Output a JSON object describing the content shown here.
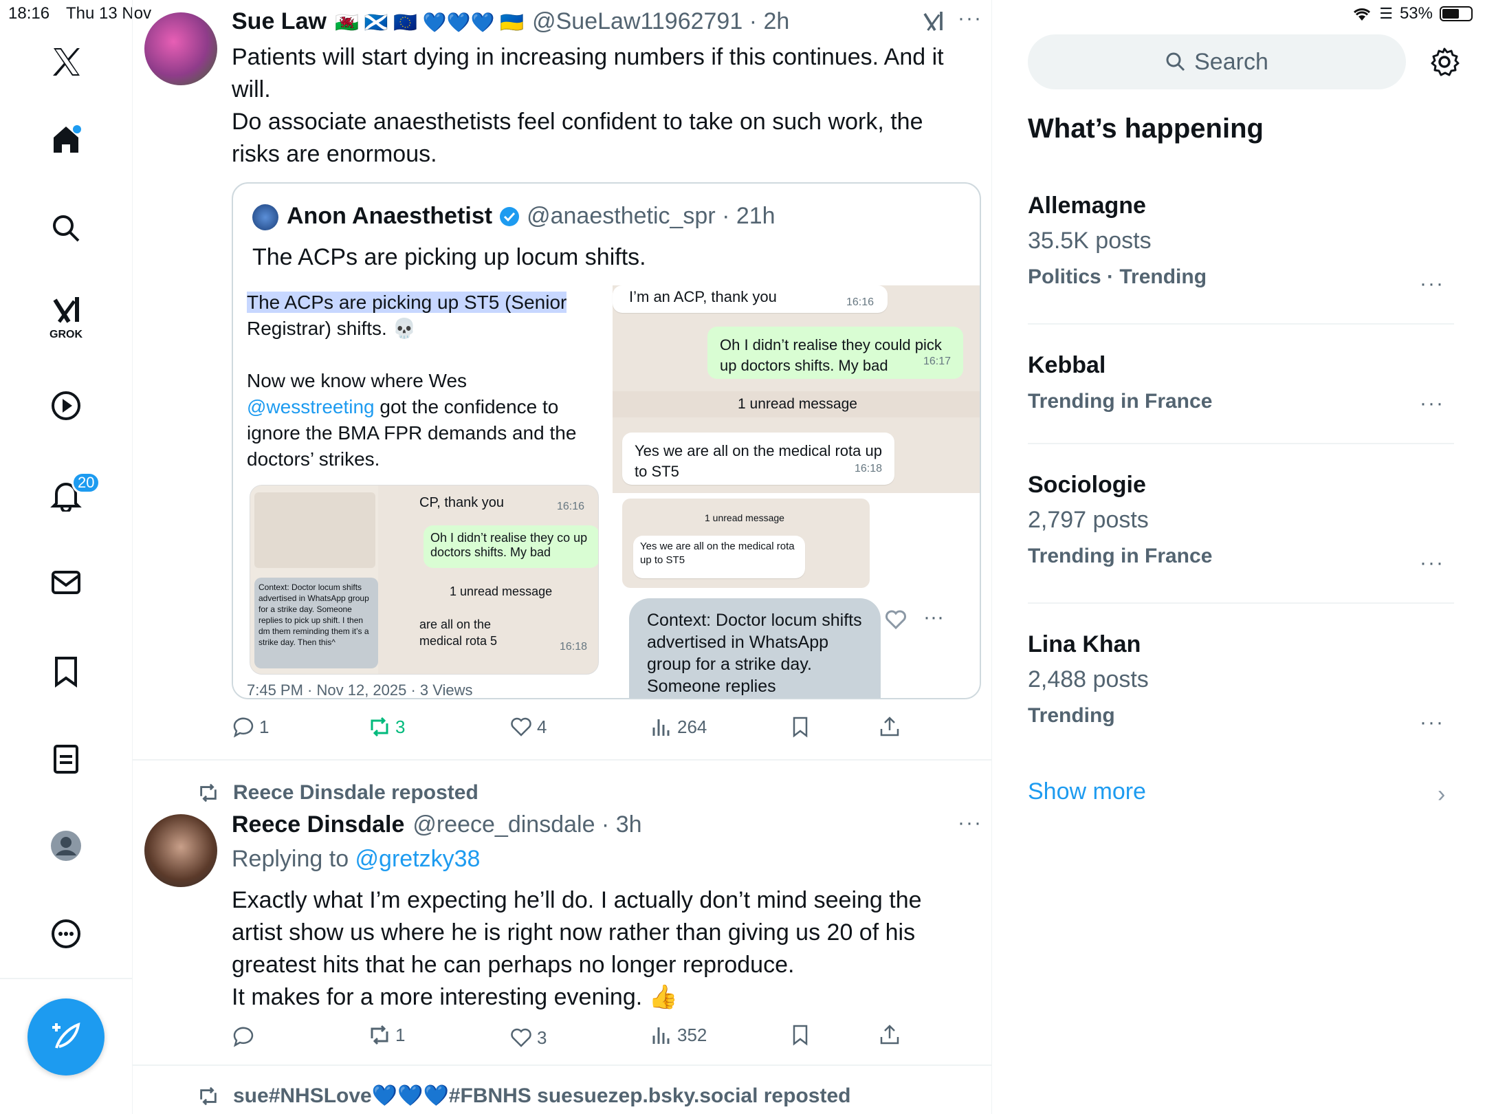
{
  "status_bar": {
    "time": "18:16",
    "date": "Thu 13 Nov",
    "battery": "53%"
  },
  "nav": {
    "grok_label": "GROK",
    "notifications_badge": "20"
  },
  "tweet1": {
    "name": "Sue Law",
    "name_emojis": "🏴󠁧󠁢󠁷󠁬󠁳󠁿 🏴󠁧󠁢󠁳󠁣󠁴󠁿 🇪🇺 💙💙💙 🇺🇦",
    "handle_time": "@SueLaw11962791 · 2h",
    "body_line1": "Patients will start dying in increasing numbers if this continues. And it",
    "body_line2": "will.",
    "body_line3": "Do associate anaesthetists feel confident to take on such work, the",
    "body_line4": "risks are enormous.",
    "quote": {
      "name": "Anon Anaesthetist",
      "handle_time": "@anaesthetic_spr · 21h",
      "text": "The ACPs are picking up locum shifts.",
      "img_left": {
        "line1": "The ACPs are picking up ST5 (Senior",
        "line2": "Registrar) shifts. 💀",
        "line3": "Now we know where Wes",
        "line4_mention": "@wesstreeting",
        "line4_rest": " got the confidence to",
        "line5": "ignore the BMA FPR demands and the",
        "line6": "doctors’ strikes."
      },
      "img_right": {
        "msg1": "I’m an ACP, thank you",
        "msg1_time": "16:16",
        "msg2": "Oh I didn’t realise they could pick up doctors shifts. My bad",
        "msg2_time": "16:17",
        "unread": "1 unread message",
        "msg3": "Yes we are all on the medical rota up to ST5",
        "msg3_time": "16:18"
      },
      "thumb": {
        "msg1": "CP, thank you",
        "msg1_time": "16:16",
        "msg2": "Oh I didn’t realise they co up doctors shifts. My bad",
        "unread": "1 unread message",
        "msg3": "are all on the medical rota 5",
        "msg3_time": "16:18",
        "context": "Context: Doctor locum shifts advertised in WhatsApp group for a strike day. Someone replies to pick up shift. I then dm them reminding them it’s a strike day. Then this^"
      },
      "context_large": "Context: Doctor locum shifts advertised in WhatsApp group for a strike day. Someone replies",
      "footer": "7:45 PM · Nov 12, 2025 · 3 Views"
    },
    "replies": "1",
    "reposts": "3",
    "likes": "4",
    "views": "264"
  },
  "tweet2": {
    "repost_label": "Reece Dinsdale reposted",
    "name": "Reece Dinsdale",
    "handle_time": "@reece_dinsdale · 3h",
    "replying_prefix": "Replying to ",
    "replying_handle": "@gretzky38",
    "body_line1": "Exactly what I’m expecting he’ll do. I actually don’t mind seeing the",
    "body_line2": "artist show us where he is right now rather than giving us 20 of his",
    "body_line3": "greatest hits that he can perhaps no longer reproduce.",
    "body_line4": "It makes for a more interesting evening. 👍",
    "reposts": "1",
    "likes": "3",
    "views": "352"
  },
  "tweet3": {
    "repost_label": "sue#NHSLove💙💙💙#FBNHS suesuezep.bsky.social reposted"
  },
  "sidebar": {
    "search_placeholder": "Search",
    "title": "What’s happening",
    "trends": [
      {
        "name": "Allemagne",
        "count": "35.5K posts",
        "meta": "Politics · Trending"
      },
      {
        "name": "Kebbal",
        "count": "",
        "meta": "Trending in France"
      },
      {
        "name": "Sociologie",
        "count": "2,797 posts",
        "meta": "Trending in France"
      },
      {
        "name": "Lina Khan",
        "count": "2,488 posts",
        "meta": "Trending"
      }
    ],
    "show_more": "Show more"
  },
  "colors": {
    "accent": "#1d9bf0",
    "repost_green": "#00ba7c",
    "muted": "#536471"
  }
}
